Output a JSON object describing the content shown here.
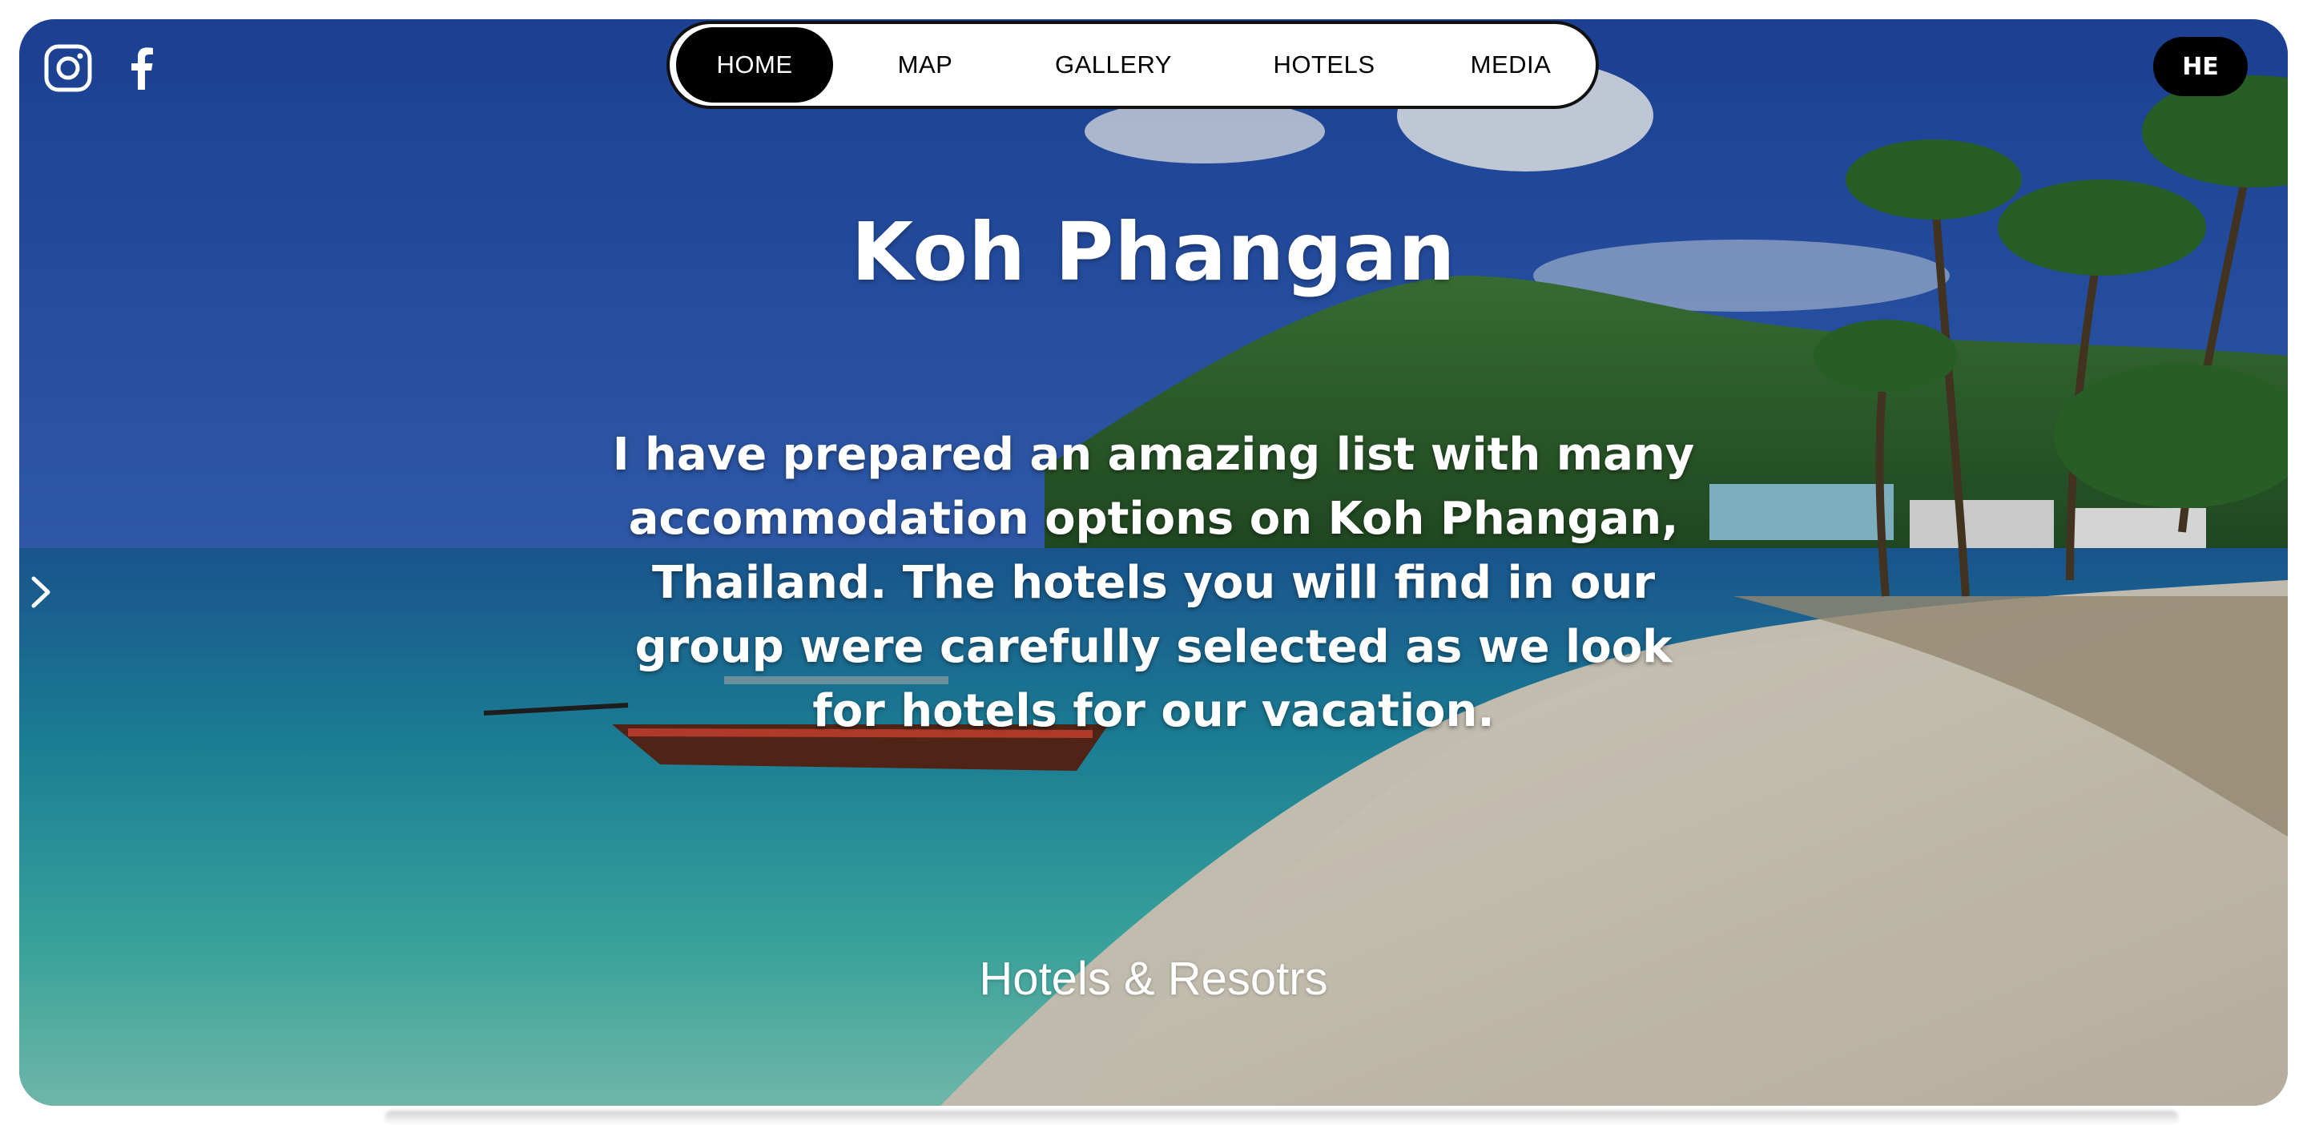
{
  "social": {
    "instagram_icon": "instagram-icon",
    "facebook_icon": "facebook-icon"
  },
  "nav": {
    "items": [
      {
        "label": "HOME",
        "active": true
      },
      {
        "label": "MAP",
        "active": false
      },
      {
        "label": "GALLERY",
        "active": false
      },
      {
        "label": "HOTELS",
        "active": false
      },
      {
        "label": "MEDIA",
        "active": false
      }
    ]
  },
  "language_button": {
    "label": "HE"
  },
  "slider": {
    "next_icon": "chevron-right-icon"
  },
  "hero": {
    "title": "Koh Phangan",
    "description": "I have prepared an amazing list with many accommodation options on Koh Phangan, Thailand. The hotels you will find in our group were carefully selected as we look for hotels for our vacation.",
    "subtitle": "Hotels & Resotrs",
    "background_image": "tropical beach with longtail boat, green mountain and palm trees"
  },
  "colors": {
    "nav_active_bg": "#000000",
    "nav_bg": "#ffffff",
    "text_light": "#ffffff"
  }
}
